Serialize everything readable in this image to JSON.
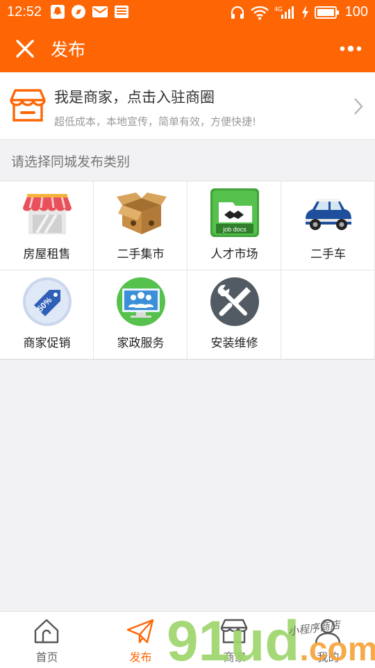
{
  "status": {
    "time": "12:52",
    "network": "4G",
    "battery": "100"
  },
  "appbar": {
    "title": "发布"
  },
  "merchant": {
    "title": "我是商家，点击入驻商圈",
    "subtitle": "超低成本，本地宣传，简单有效，方便快捷!"
  },
  "section": {
    "label": "请选择同城发布类别"
  },
  "categories": [
    {
      "label": "房屋租售",
      "icon": "shop-awning-icon"
    },
    {
      "label": "二手集市",
      "icon": "cardboard-box-icon"
    },
    {
      "label": "人才市场",
      "icon": "job-docs-icon",
      "icon_text": "job docs"
    },
    {
      "label": "二手车",
      "icon": "car-icon"
    },
    {
      "label": "商家促销",
      "icon": "discount-tag-icon",
      "icon_text": "50%"
    },
    {
      "label": "家政服务",
      "icon": "people-monitor-icon"
    },
    {
      "label": "安装维修",
      "icon": "wrench-screwdriver-icon"
    }
  ],
  "tabs": [
    {
      "label": "首页",
      "icon": "home-icon",
      "active": false
    },
    {
      "label": "发布",
      "icon": "paper-plane-icon",
      "active": true
    },
    {
      "label": "商家",
      "icon": "store-icon",
      "active": false
    },
    {
      "label": "我的",
      "icon": "user-icon",
      "active": false
    }
  ],
  "watermark": {
    "text": "91ud.com",
    "script": "小程序商店"
  },
  "colors": {
    "accent": "#fe6605",
    "watermark_green": "#9ed56b",
    "watermark_orange": "#f6a33a"
  }
}
